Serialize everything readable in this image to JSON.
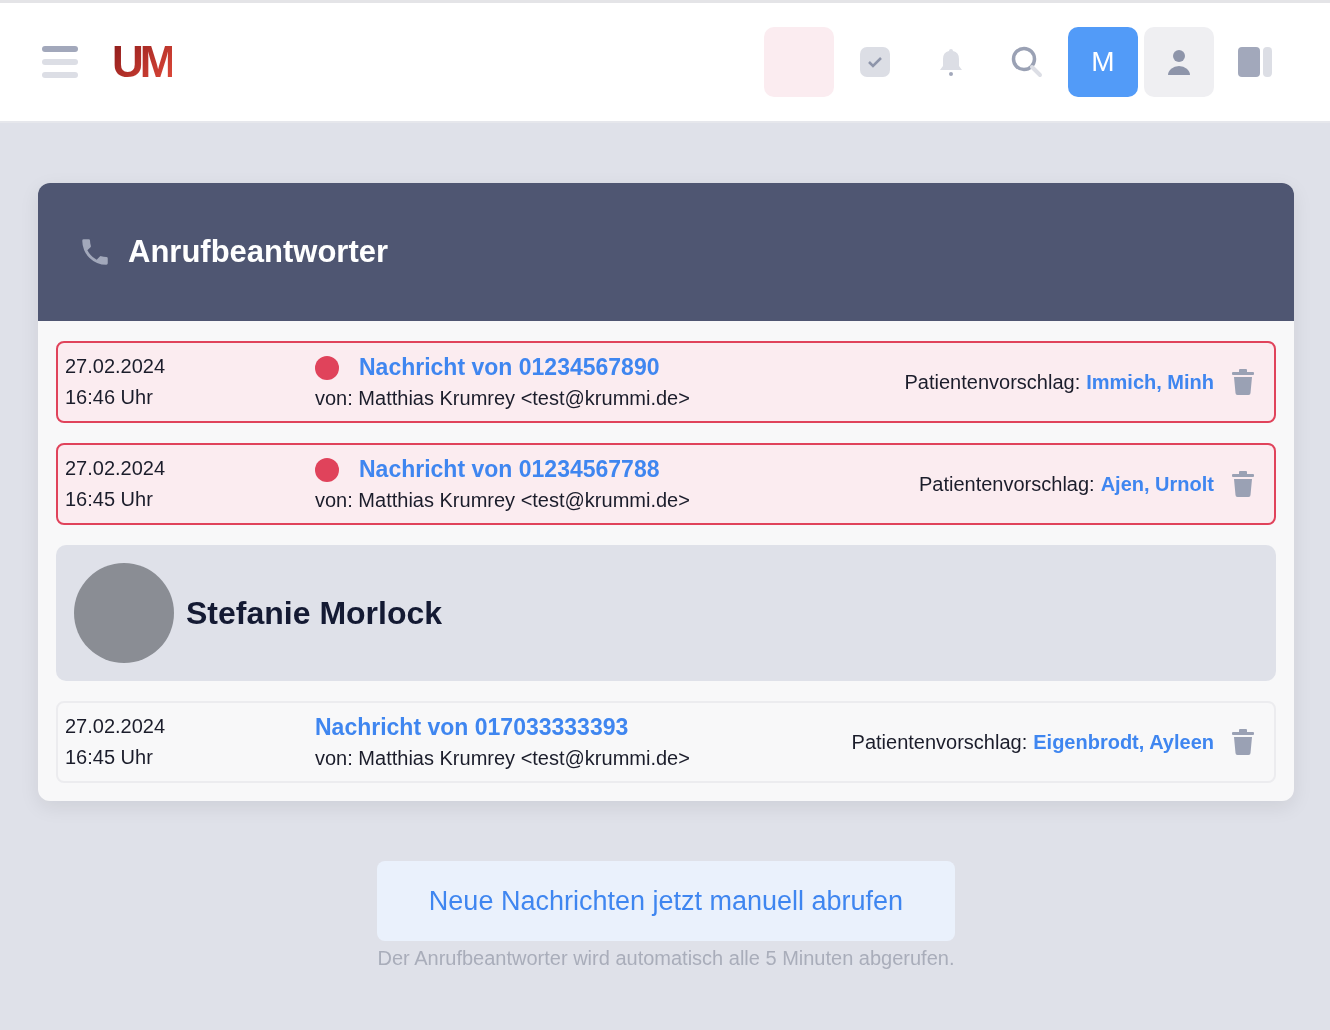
{
  "header": {
    "logo": "UM",
    "avatar_initial": "M"
  },
  "panel": {
    "title": "Anrufbeantworter",
    "entries": [
      {
        "kind": "message",
        "unread": true,
        "date": "27.02.2024",
        "time": "16:46 Uhr",
        "title": "Nachricht von 01234567890",
        "sender": "von: Matthias Krumrey <test@krummi.de>",
        "suggestion_label": "Patientenvorschlag:",
        "suggestion": "Immich, Minh"
      },
      {
        "kind": "message",
        "unread": true,
        "date": "27.02.2024",
        "time": "16:45 Uhr",
        "title": "Nachricht von 01234567788",
        "sender": "von: Matthias Krumrey <test@krummi.de>",
        "suggestion_label": "Patientenvorschlag:",
        "suggestion": "Ajen, Urnolt"
      },
      {
        "kind": "person",
        "name": "Stefanie Morlock"
      },
      {
        "kind": "message",
        "unread": false,
        "date": "27.02.2024",
        "time": "16:45 Uhr",
        "title": "Nachricht von 017033333393",
        "sender": "von: Matthias Krumrey <test@krummi.de>",
        "suggestion_label": "Patientenvorschlag:",
        "suggestion": "Eigenbrodt, Ayleen"
      }
    ]
  },
  "fetch_button": "Neue Nachrichten jetzt manuell abrufen",
  "note": "Der Anrufbeantworter wird automatisch alle 5 Minuten abgerufen."
}
